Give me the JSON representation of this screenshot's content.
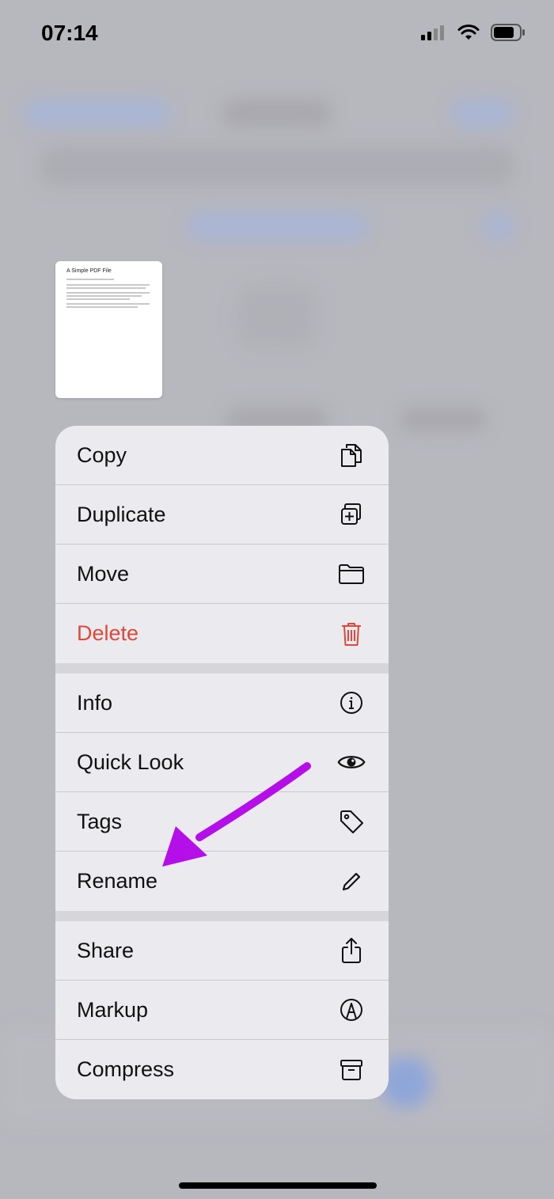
{
  "status": {
    "time": "07:14"
  },
  "preview": {
    "file_title": "A Simple PDF File"
  },
  "menu": {
    "items": [
      {
        "label": "Copy",
        "icon": "doc-on-doc-icon"
      },
      {
        "label": "Duplicate",
        "icon": "plus-square-on-square-icon"
      },
      {
        "label": "Move",
        "icon": "folder-icon"
      },
      {
        "label": "Delete",
        "icon": "trash-icon",
        "destructive": true
      },
      {
        "label": "Info",
        "icon": "info-circle-icon"
      },
      {
        "label": "Quick Look",
        "icon": "eye-icon"
      },
      {
        "label": "Tags",
        "icon": "tag-icon"
      },
      {
        "label": "Rename",
        "icon": "pencil-icon"
      },
      {
        "label": "Share",
        "icon": "share-icon"
      },
      {
        "label": "Markup",
        "icon": "markup-pen-icon"
      },
      {
        "label": "Compress",
        "icon": "archive-box-icon"
      }
    ]
  },
  "colors": {
    "destructive": "#e0473b",
    "annotation_arrow": "#b40fe8",
    "menu_background": "#ebebef"
  }
}
